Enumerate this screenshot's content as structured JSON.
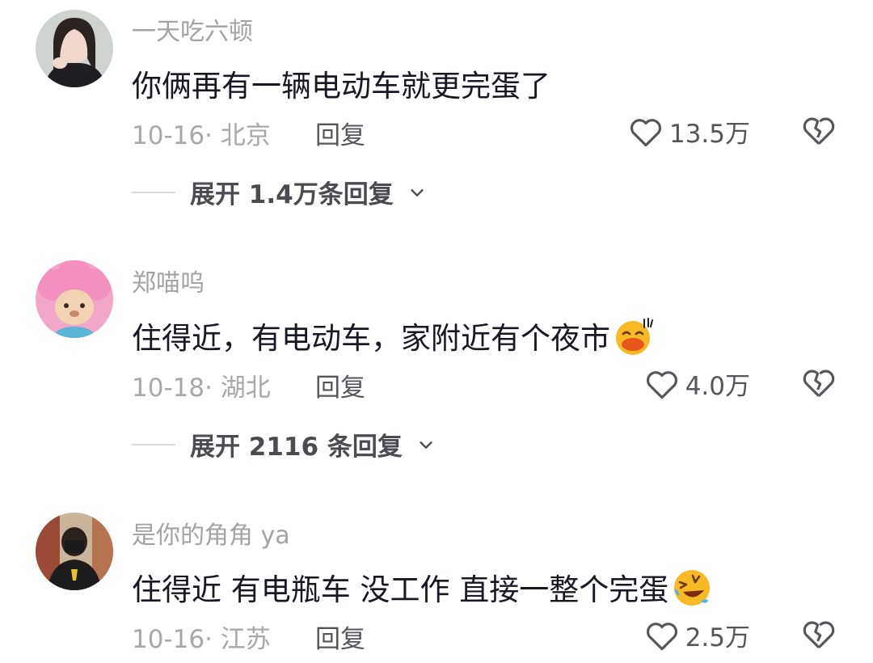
{
  "comments": [
    {
      "username": "一天吃六顿",
      "text": "你俩再有一辆电动车就更完蛋了",
      "date_location": "10-16· 北京",
      "reply_label": "回复",
      "likes": "13.5万",
      "expand_label": "展开 1.4万条回复"
    },
    {
      "username": "郑喵呜",
      "text": "住得近，有电动车，家附近有个夜市",
      "emoji": "laughing-sweat-emoji",
      "date_location": "10-18· 湖北",
      "reply_label": "回复",
      "likes": "4.0万",
      "expand_label": "展开 2116 条回复"
    },
    {
      "username": "是你的角角 ya",
      "text": "住得近 有电瓶车 没工作 直接一整个完蛋",
      "emoji": "rolling-laugh-emoji",
      "date_location": "10-16· 江苏",
      "reply_label": "回复",
      "likes": "2.5万"
    }
  ],
  "icons": {
    "like": "heart-outline-icon",
    "dislike": "broken-heart-icon",
    "expand": "chevron-down-icon"
  },
  "colors": {
    "text": "#161823",
    "muted": "#a7a7ac",
    "icon": "#55555c"
  }
}
